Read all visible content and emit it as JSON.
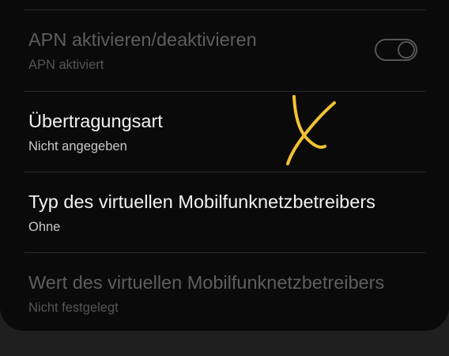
{
  "settings": {
    "items": [
      {
        "title": "APN aktivieren/deaktivieren",
        "subtitle": "APN aktiviert",
        "state": "disabled",
        "toggle": "on"
      },
      {
        "title": "Übertragungsart",
        "subtitle": "Nicht angegeben",
        "state": "enabled"
      },
      {
        "title": "Typ des virtuellen Mobilfunknetzbetreibers",
        "subtitle": "Ohne",
        "state": "enabled"
      },
      {
        "title": "Wert des virtuellen Mobilfunknetzbetreibers",
        "subtitle": "Nicht festgelegt",
        "state": "disabled"
      }
    ]
  },
  "colors": {
    "background": "#0a0a0a",
    "outer_background": "#1f1f1f",
    "annotation": "#f2c233"
  },
  "annotation": {
    "shape": "handwritten-x-mark"
  }
}
